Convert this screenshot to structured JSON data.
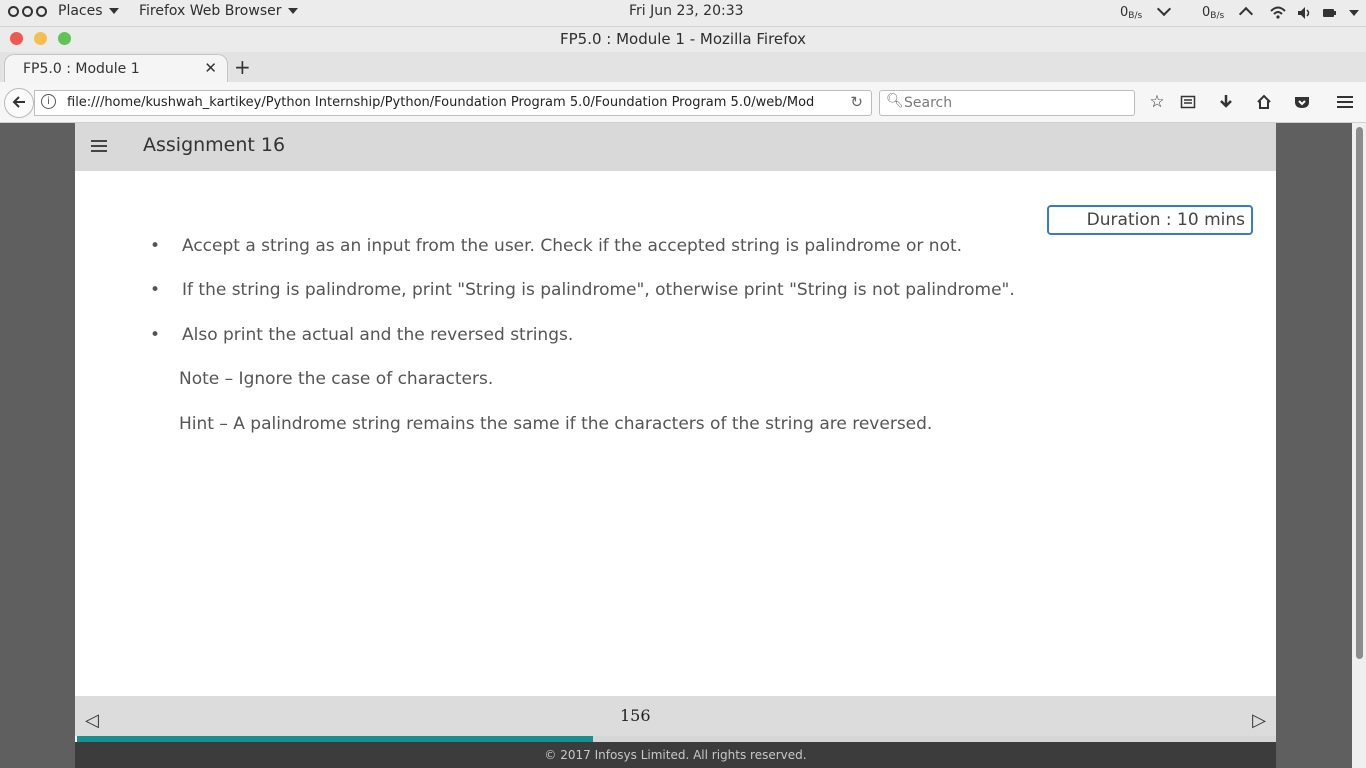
{
  "topbar": {
    "places": "Places",
    "app_menu": "Firefox Web Browser",
    "clock": "Fri Jun 23, 20:33",
    "net_down": "0",
    "net_down_unit": "B/s",
    "net_up": "0",
    "net_up_unit": "B/s"
  },
  "window": {
    "title": "FP5.0 : Module 1 - Mozilla Firefox"
  },
  "tabs": [
    {
      "label": "FP5.0 : Module 1"
    }
  ],
  "navbar": {
    "url": "file:///home/kushwah_kartikey/Python Internship/Python/Foundation Program 5.0/Foundation Program 5.0/web/Mod",
    "search_placeholder": "Search"
  },
  "page": {
    "header_title": "Assignment 16",
    "duration": "Duration : 10 mins",
    "bullets": [
      "Accept a string as an input from the user. Check if the accepted string is palindrome or not.",
      "If the string is palindrome, print \"String is palindrome\", otherwise print \"String is not palindrome\".",
      "Also print the actual and the reversed strings."
    ],
    "note": "Note – Ignore the case of characters.",
    "hint": "Hint – A palindrome string remains the same if the characters of the string are reversed.",
    "page_number": "156",
    "progress_fraction": 0.43,
    "copyright": "© 2017 Infosys Limited. All rights reserved."
  },
  "colors": {
    "accent_border": "#3a7bc8",
    "progress": "#1a8f8f",
    "close": "#ee5a52",
    "minimize": "#f5be4f",
    "maximize": "#5fc454"
  }
}
